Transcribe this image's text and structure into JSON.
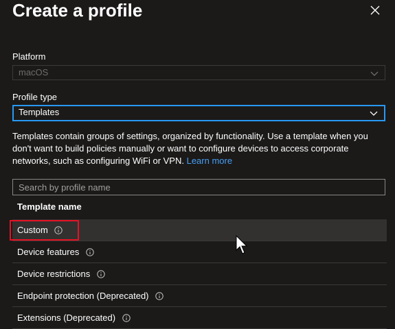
{
  "panel": {
    "title": "Create a profile",
    "close_icon": "close-icon"
  },
  "platform": {
    "label": "Platform",
    "value": "macOS"
  },
  "profile_type": {
    "label": "Profile type",
    "value": "Templates"
  },
  "description": {
    "text": "Templates contain groups of settings, organized by functionality. Use a template when you don't want to build policies manually or want to configure devices to access corporate networks, such as configuring WiFi or VPN. ",
    "link": "Learn more"
  },
  "search": {
    "placeholder": "Search by profile name"
  },
  "table": {
    "column_header": "Template name",
    "rows": [
      {
        "name": "Custom"
      },
      {
        "name": "Device features"
      },
      {
        "name": "Device restrictions"
      },
      {
        "name": "Endpoint protection (Deprecated)"
      },
      {
        "name": "Extensions (Deprecated)"
      }
    ]
  },
  "colors": {
    "background": "#1b1a19",
    "accent": "#2899f5",
    "link": "#479ef5",
    "highlight": "#e81123",
    "selected_row": "#323130"
  }
}
